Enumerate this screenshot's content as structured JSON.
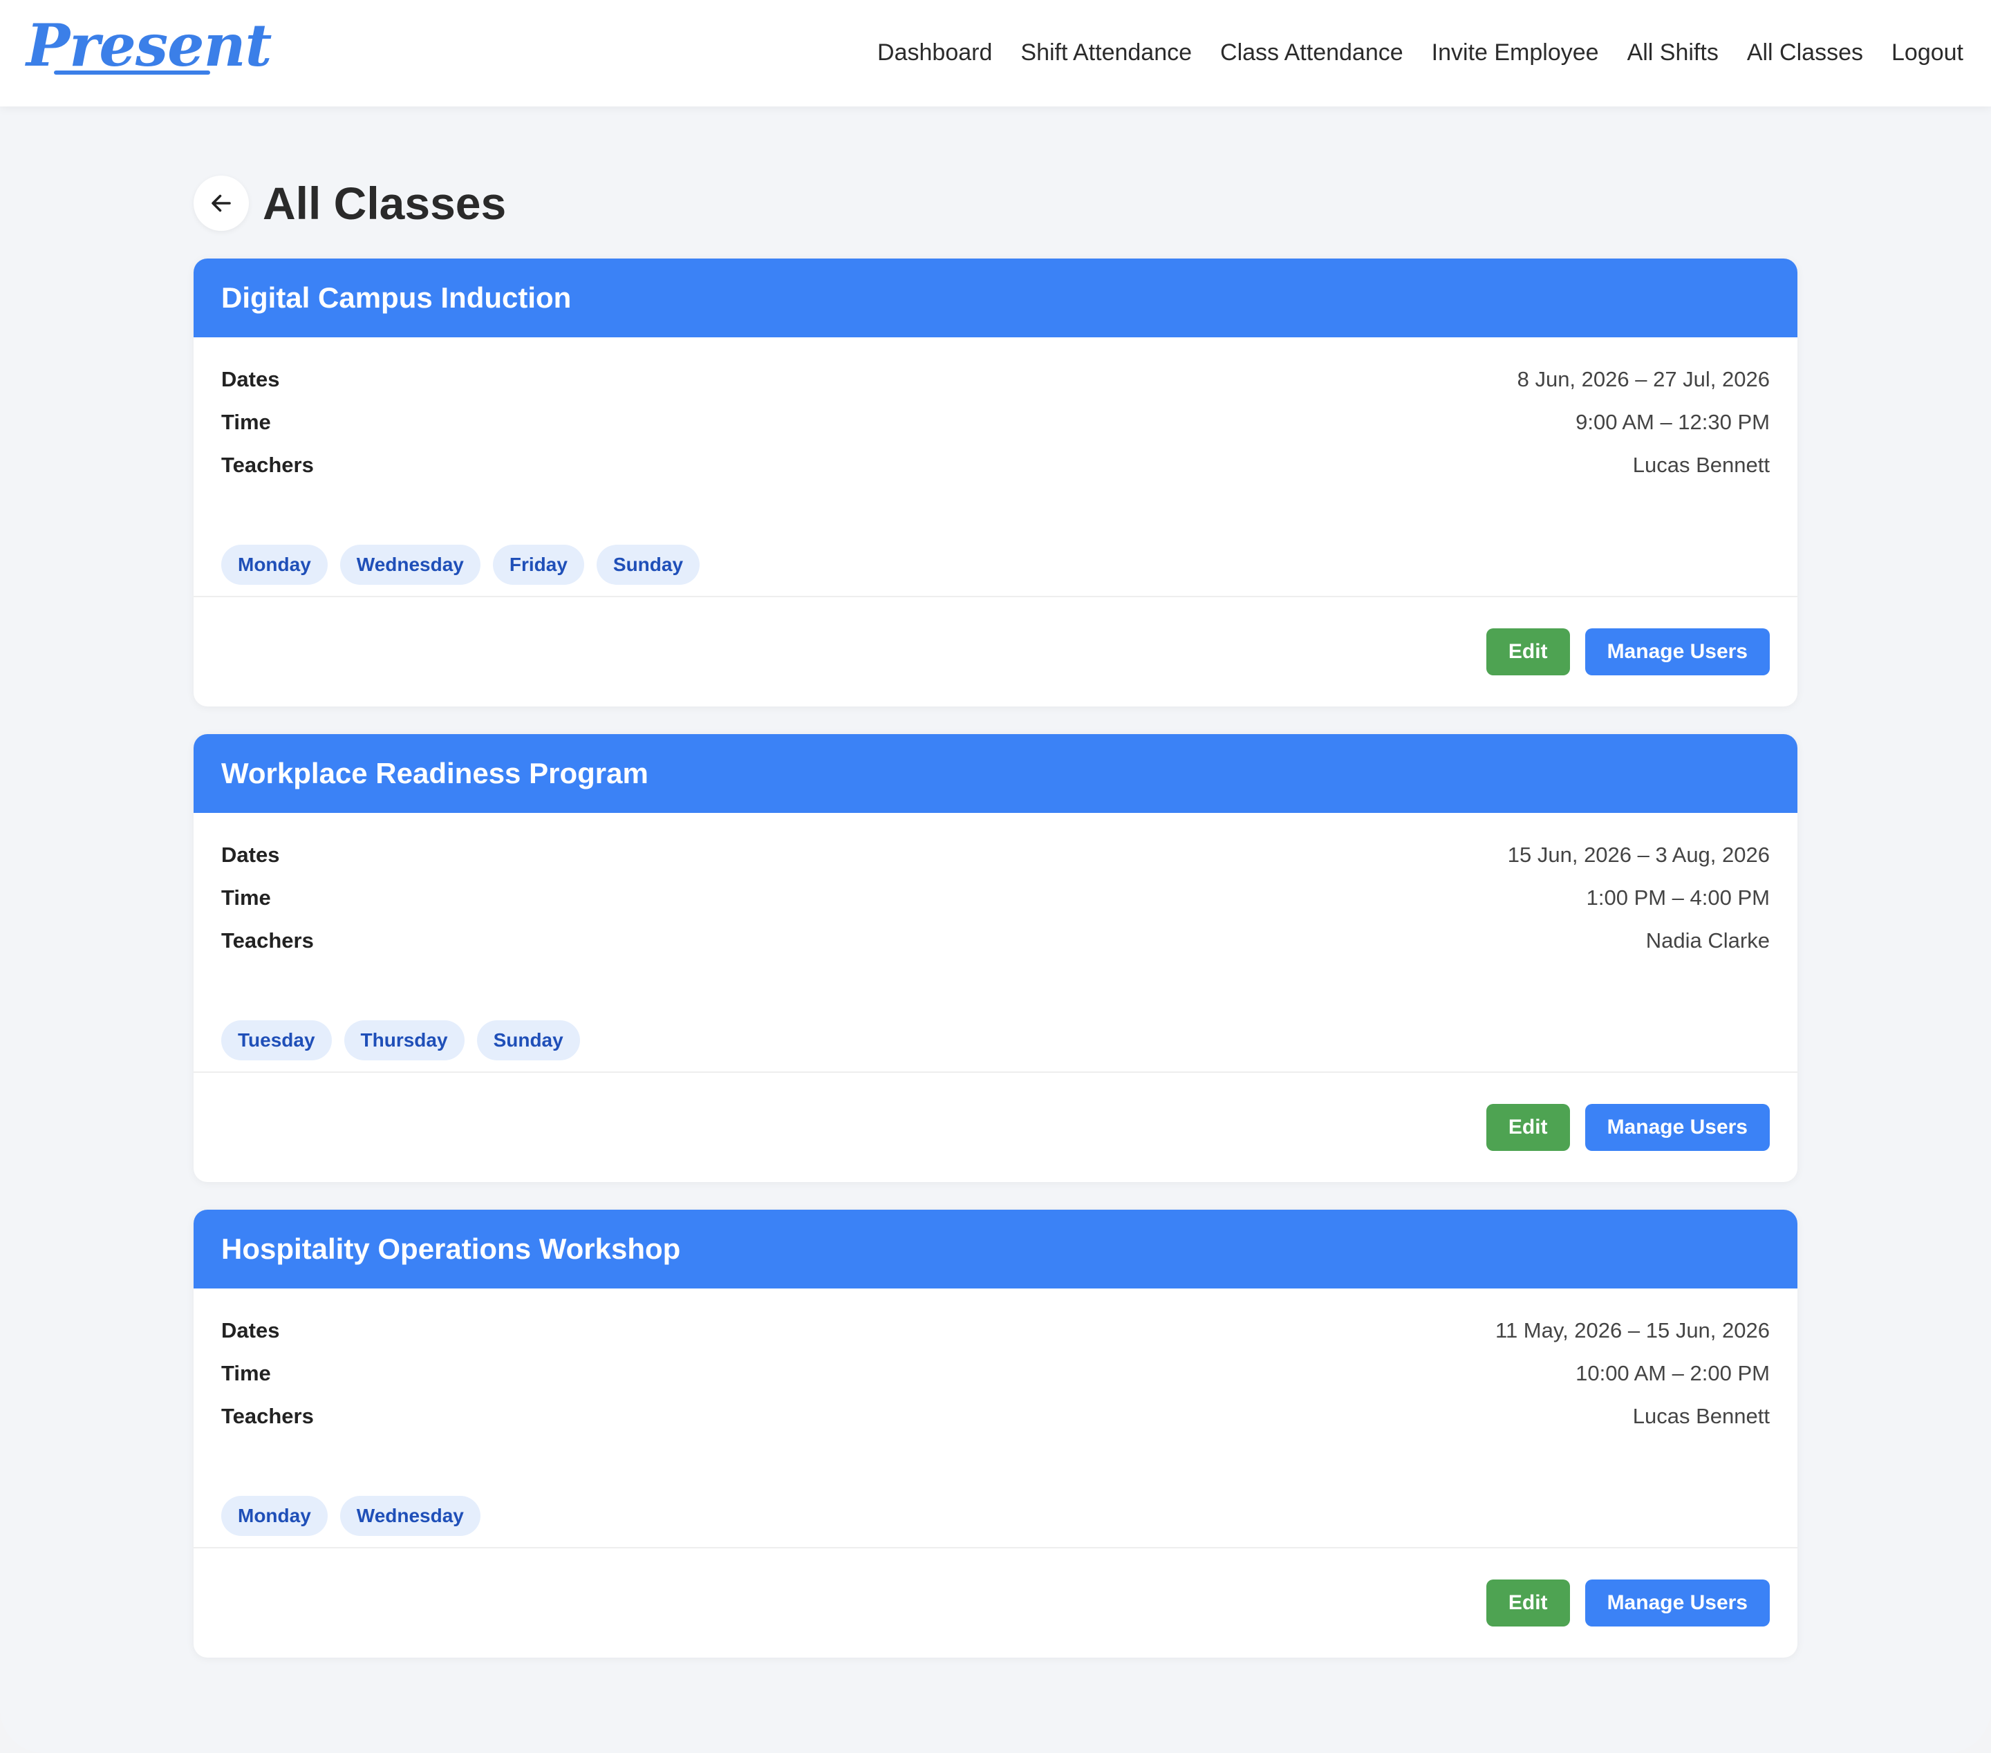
{
  "brand": {
    "logo_text": "Present",
    "accent_color": "#3b82f6"
  },
  "nav": {
    "items": [
      {
        "label": "Dashboard"
      },
      {
        "label": "Shift Attendance"
      },
      {
        "label": "Class Attendance"
      },
      {
        "label": "Invite Employee"
      },
      {
        "label": "All Shifts"
      },
      {
        "label": "All Classes"
      },
      {
        "label": "Logout"
      }
    ]
  },
  "page": {
    "title": "All Classes",
    "back_icon": "arrow-left-icon"
  },
  "labels": {
    "dates": "Dates",
    "time": "Time",
    "teachers": "Teachers",
    "edit": "Edit",
    "manage_users": "Manage Users"
  },
  "classes": [
    {
      "name": "Digital Campus Induction",
      "dates": "8 Jun, 2026 – 27 Jul, 2026",
      "time": "9:00 AM – 12:30 PM",
      "teachers": "Lucas Bennett",
      "days": [
        "Monday",
        "Wednesday",
        "Friday",
        "Sunday"
      ]
    },
    {
      "name": "Workplace Readiness Program",
      "dates": "15 Jun, 2026 – 3 Aug, 2026",
      "time": "1:00 PM – 4:00 PM",
      "teachers": "Nadia Clarke",
      "days": [
        "Tuesday",
        "Thursday",
        "Sunday"
      ]
    },
    {
      "name": "Hospitality Operations Workshop",
      "dates": "11 May, 2026 – 15 Jun, 2026",
      "time": "10:00 AM – 2:00 PM",
      "teachers": "Lucas Bennett",
      "days": [
        "Monday",
        "Wednesday"
      ]
    }
  ],
  "colors": {
    "header_blue": "#3b82f6",
    "edit_green": "#4ea352",
    "pill_bg": "#e5eefc",
    "pill_text": "#1f4fb8"
  }
}
